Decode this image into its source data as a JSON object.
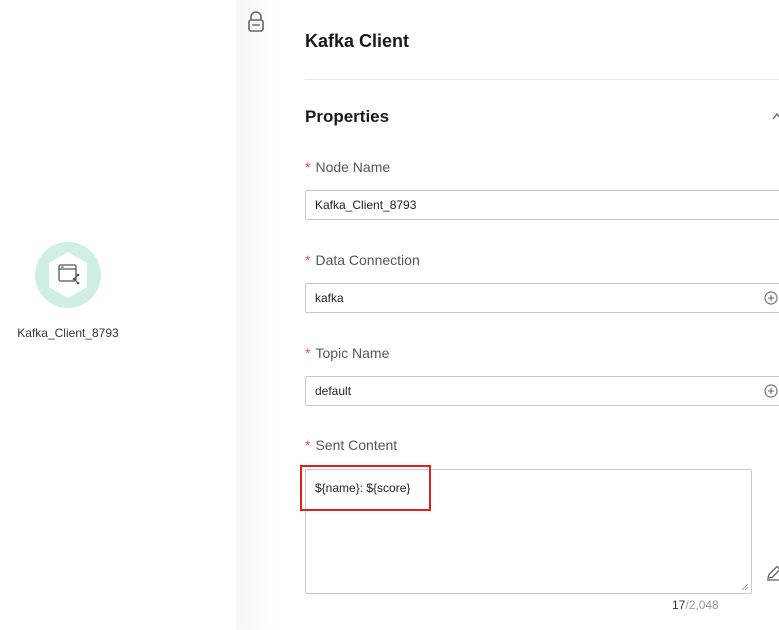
{
  "canvas": {
    "node": {
      "label": "Kafka_Client_8793",
      "icon": "kafka-client-node-icon",
      "ring_color": "#cfeee4"
    }
  },
  "toolbar": {
    "lock_icon": "lock-icon"
  },
  "panel": {
    "title": "Kafka Client",
    "section_title": "Properties",
    "required_mark": "*",
    "fields": {
      "node_name": {
        "label": "Node Name",
        "value": "Kafka_Client_8793"
      },
      "data_connection": {
        "label": "Data Connection",
        "value": "kafka"
      },
      "topic_name": {
        "label": "Topic Name",
        "value": "default"
      },
      "sent_content": {
        "label": "Sent Content",
        "value": "${name}: ${score}",
        "count_current": "17",
        "count_max": "/2,048"
      }
    }
  },
  "colors": {
    "required": "#e84e4e",
    "highlight_box": "#e0201d",
    "node_ring": "#cfeee4"
  }
}
